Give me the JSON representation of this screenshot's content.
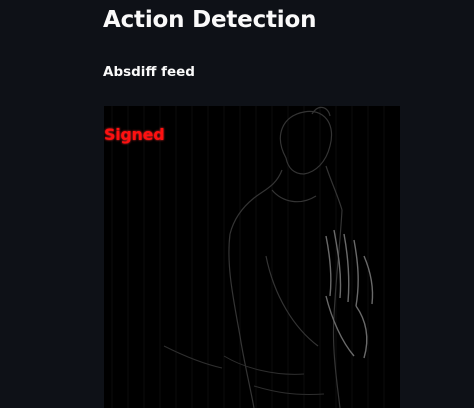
{
  "app": {
    "title": "Action Detection"
  },
  "feed": {
    "subtitle": "Absdiff feed",
    "overlay_label": "Signed",
    "overlay_color": "#ff1010"
  },
  "theme": {
    "background": "#0e1117",
    "text": "#fafafa"
  }
}
